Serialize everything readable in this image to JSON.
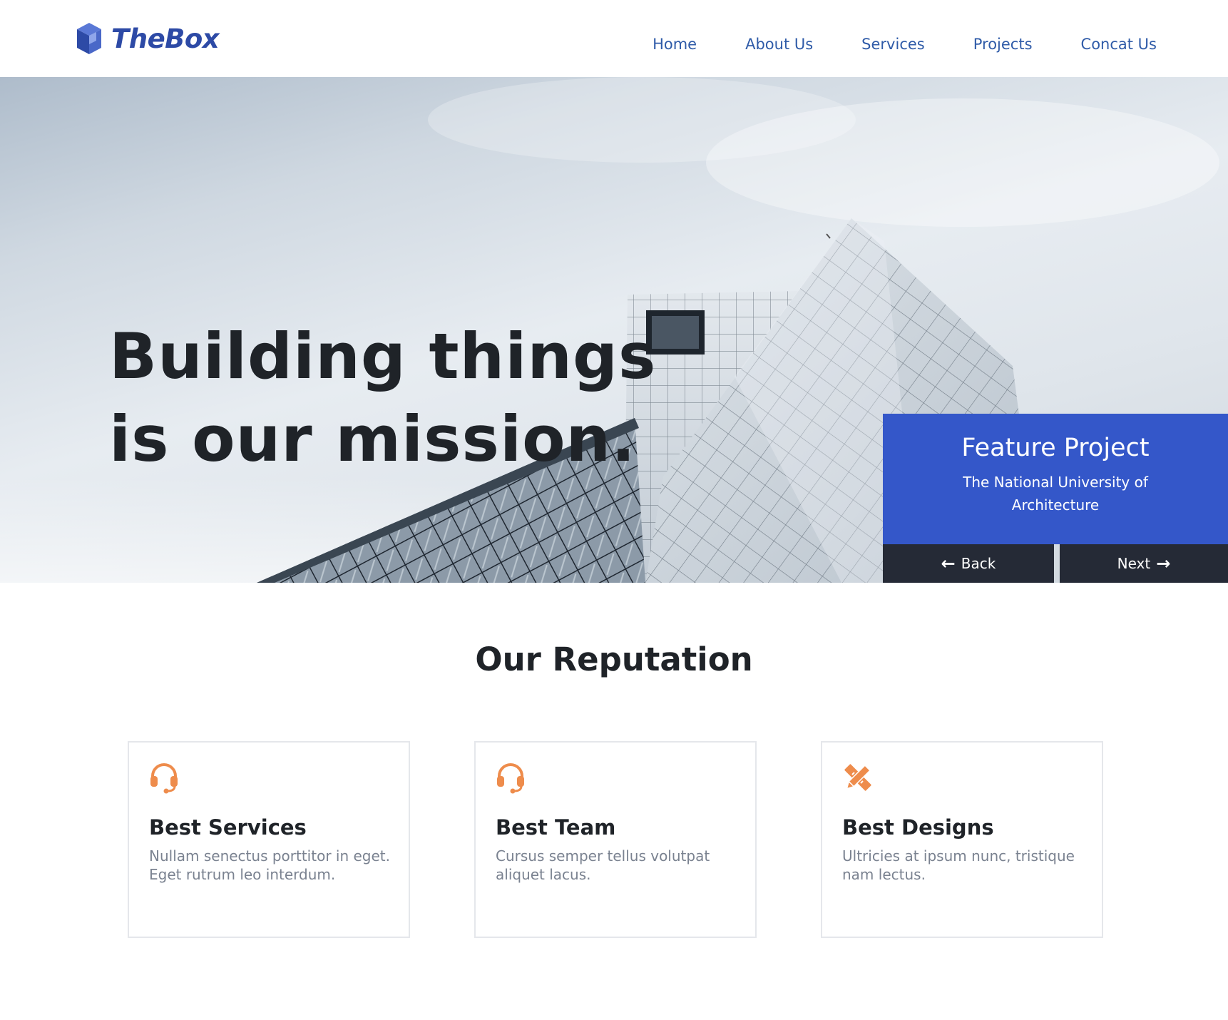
{
  "brand": {
    "name": "TheBox",
    "logo_icon": "cube-logo-icon",
    "color": "#2d4aa6"
  },
  "nav": {
    "items": [
      {
        "label": "Home"
      },
      {
        "label": "About Us"
      },
      {
        "label": "Services"
      },
      {
        "label": "Projects"
      },
      {
        "label": "Concat Us"
      }
    ],
    "color": "#2f5ba8"
  },
  "hero": {
    "title_line1": "Building things",
    "title_line2": "is our mission.",
    "background": "building-photo"
  },
  "feature": {
    "title": "Feature Project",
    "subtitle": "The National University of Architecture",
    "back_label": "Back",
    "next_label": "Next",
    "back_icon": "arrow-left-icon",
    "next_icon": "arrow-right-icon",
    "panel_color": "#3457c9",
    "button_color": "#252a36"
  },
  "reputation": {
    "title": "Our Reputation",
    "accent_color": "#ee8c4c",
    "cards": [
      {
        "icon": "headset-icon",
        "title": "Best Services",
        "text": "Nullam senectus porttitor in eget. Eget rutrum leo interdum."
      },
      {
        "icon": "headset-icon",
        "title": "Best Team",
        "text": "Cursus semper tellus volutpat aliquet lacus."
      },
      {
        "icon": "pencil-ruler-icon",
        "title": "Best Designs",
        "text": "Ultricies at ipsum nunc, tristique nam lectus."
      }
    ]
  }
}
